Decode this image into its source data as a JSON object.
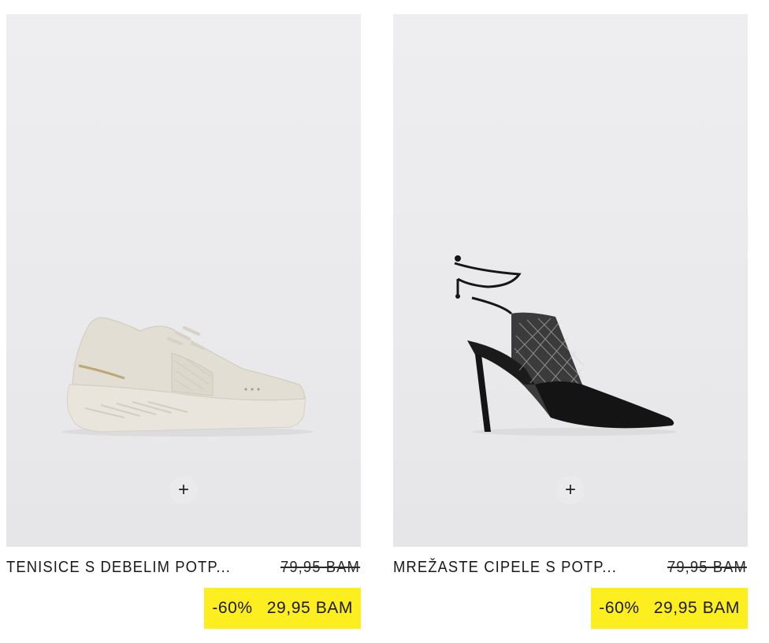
{
  "products": [
    {
      "title": "TENISICE S DEBELIM POTP...",
      "old_price": "79,95 BAM",
      "discount": "-60%",
      "price": "29,95 BAM",
      "add_symbol": "+"
    },
    {
      "title": "MREŽASTE CIPELE S POTP...",
      "old_price": "79,95 BAM",
      "discount": "-60%",
      "price": "29,95 BAM",
      "add_symbol": "+"
    }
  ],
  "colors": {
    "sale_badge": "#fdee1f",
    "text": "#1a1a1a",
    "image_background": "#ebebed"
  }
}
